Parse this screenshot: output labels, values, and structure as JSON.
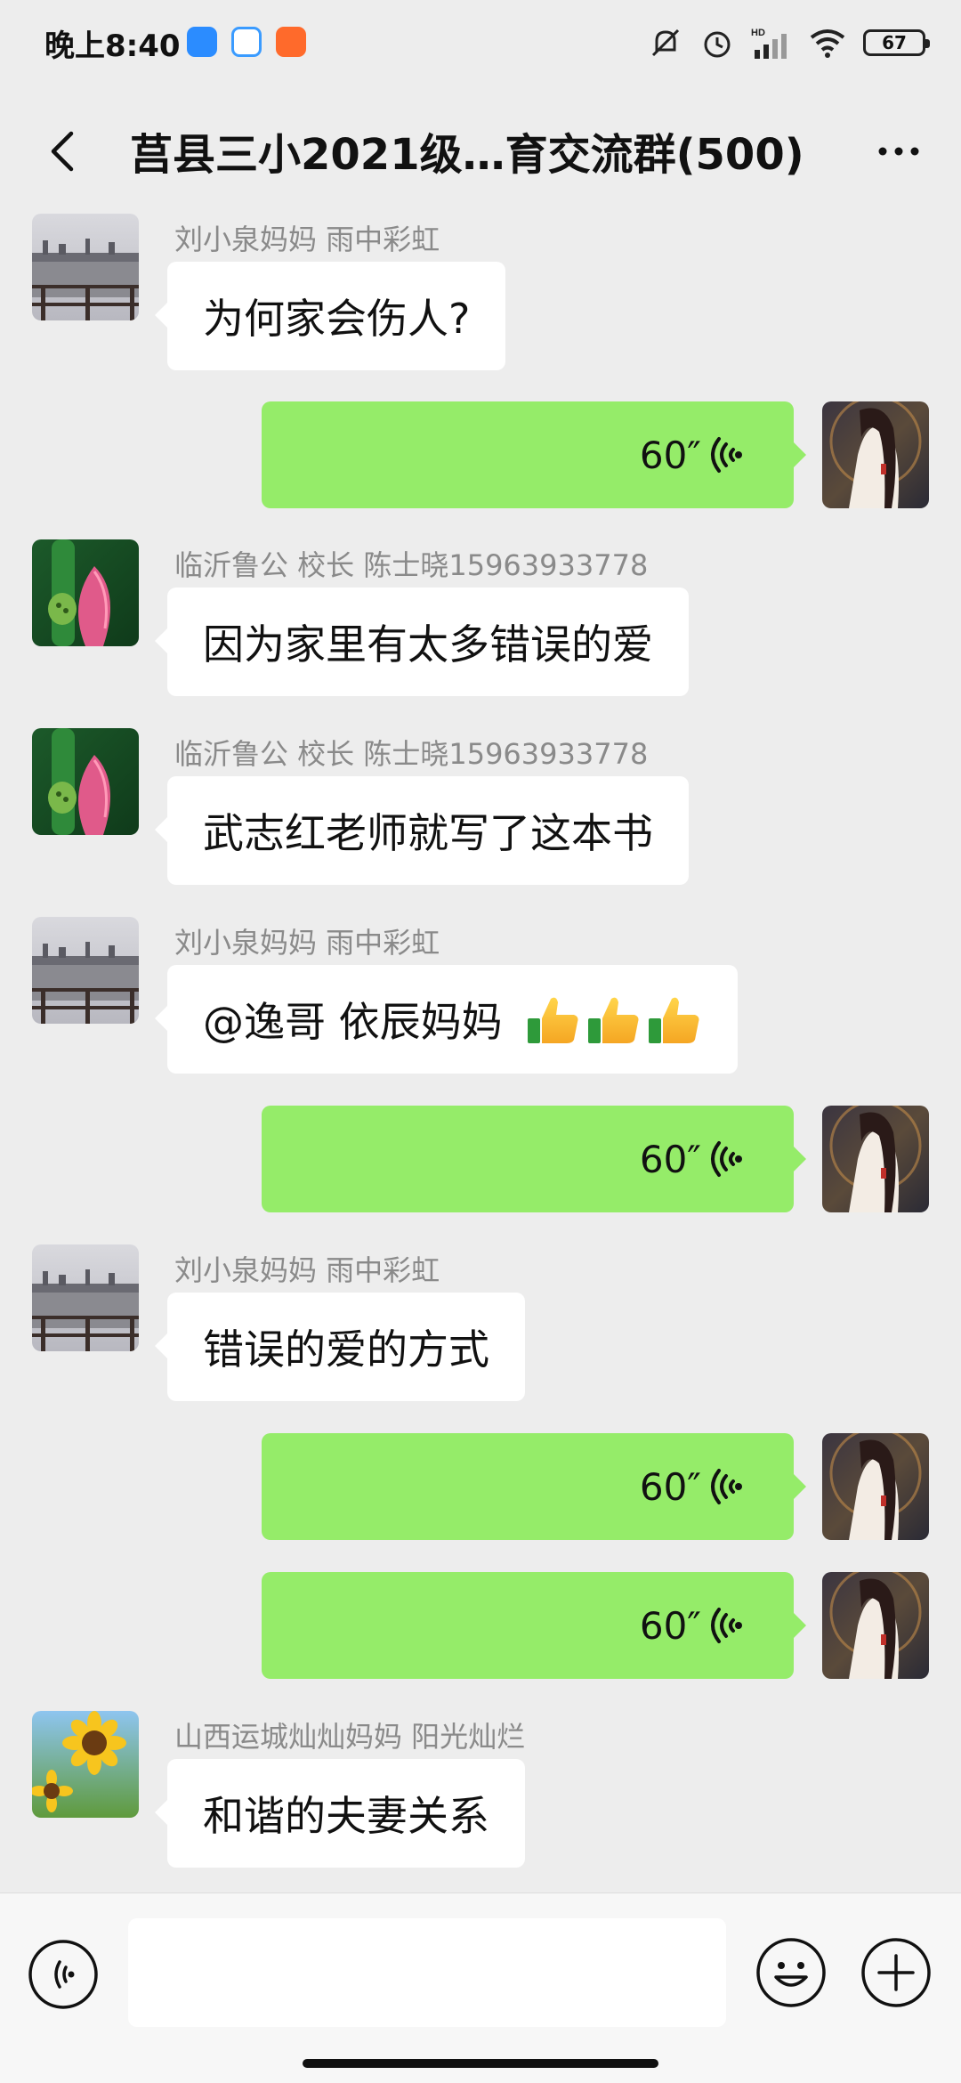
{
  "status_bar": {
    "time": "晚上8:40",
    "battery": "67",
    "network_label": "HD"
  },
  "header": {
    "title": "莒县三小2021级…育交流群(500)",
    "back_icon": "chevron-left-icon",
    "more_icon": "more-dots-icon"
  },
  "messages": [
    {
      "type": "text",
      "direction": "in",
      "sender": "刘小泉妈妈  雨中彩虹",
      "text": "为何家会伤人?",
      "avatar": "lake-avatar"
    },
    {
      "type": "voice",
      "direction": "out",
      "duration": "60″",
      "avatar": "girl-avatar"
    },
    {
      "type": "text",
      "direction": "in",
      "sender": "临沂鲁公 校长  陈士晓15963933778",
      "text": "因为家里有太多错误的爱",
      "avatar": "lotus-avatar"
    },
    {
      "type": "text",
      "direction": "in",
      "sender": "临沂鲁公 校长  陈士晓15963933778",
      "text": "武志红老师就写了这本书",
      "avatar": "lotus-avatar"
    },
    {
      "type": "text",
      "direction": "in",
      "sender": "刘小泉妈妈  雨中彩虹",
      "text": "@逸哥 依辰妈妈",
      "emojis": [
        "thumbs-up-icon",
        "thumbs-up-icon",
        "thumbs-up-icon"
      ],
      "avatar": "lake-avatar"
    },
    {
      "type": "voice",
      "direction": "out",
      "duration": "60″",
      "avatar": "girl-avatar"
    },
    {
      "type": "text",
      "direction": "in",
      "sender": "刘小泉妈妈  雨中彩虹",
      "text": "错误的爱的方式",
      "avatar": "lake-avatar"
    },
    {
      "type": "voice",
      "direction": "out",
      "duration": "60″",
      "avatar": "girl-avatar"
    },
    {
      "type": "voice",
      "direction": "out",
      "duration": "60″",
      "avatar": "girl-avatar"
    },
    {
      "type": "text",
      "direction": "in",
      "sender": "山西运城灿灿妈妈  阳光灿烂",
      "text": "和谐的夫妻关系",
      "avatar": "sunflower-avatar"
    }
  ],
  "input_bar": {
    "voice_icon": "voice-mode-icon",
    "emoji_icon": "smiley-icon",
    "plus_icon": "plus-circle-icon",
    "input_value": ""
  },
  "colors": {
    "background": "#ededed",
    "outgoing_bubble": "#95ec69",
    "incoming_bubble": "#ffffff",
    "sender_name": "#8a8a8a"
  }
}
